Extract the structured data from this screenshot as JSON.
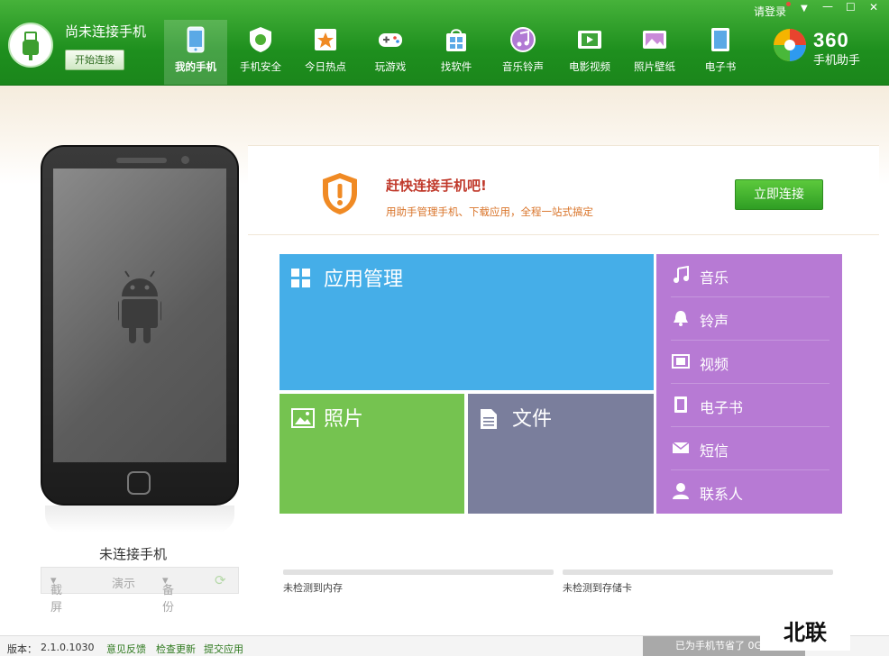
{
  "header": {
    "phone_status": "尚未连接手机",
    "connect_button": "开始连接",
    "tabs": [
      {
        "label": "我的手机",
        "icon": "phone-icon"
      },
      {
        "label": "手机安全",
        "icon": "shield-icon"
      },
      {
        "label": "今日热点",
        "icon": "star-icon"
      },
      {
        "label": "玩游戏",
        "icon": "gamepad-icon"
      },
      {
        "label": "找软件",
        "icon": "app-bag-icon"
      },
      {
        "label": "音乐铃声",
        "icon": "music-icon"
      },
      {
        "label": "电影视频",
        "icon": "film-icon"
      },
      {
        "label": "照片壁纸",
        "icon": "photo-icon"
      },
      {
        "label": "电子书",
        "icon": "book-icon"
      }
    ],
    "login": "请登录",
    "logo_number": "360",
    "logo_text": "手机助手"
  },
  "device": {
    "label": "未连接手机",
    "tools": [
      "截屏",
      "演示",
      "备份"
    ]
  },
  "notice": {
    "title": "赶快连接手机吧!",
    "desc": "用助手管理手机、下载应用，全程一站式搞定",
    "button": "立即连接"
  },
  "tiles": {
    "app": "应用管理",
    "photo": "照片",
    "file": "文件",
    "side": [
      {
        "label": "音乐",
        "icon": "music-note-icon"
      },
      {
        "label": "铃声",
        "icon": "bell-icon"
      },
      {
        "label": "视频",
        "icon": "film-strip-icon"
      },
      {
        "label": "电子书",
        "icon": "ebook-icon"
      },
      {
        "label": "短信",
        "icon": "envelope-icon"
      },
      {
        "label": "联系人",
        "icon": "contact-icon"
      }
    ]
  },
  "storage": {
    "memory": "未检测到内存",
    "card": "未检测到存储卡"
  },
  "status": {
    "version_label": "版本：",
    "version": "2.1.0.1030",
    "feedback": "意见反馈",
    "check_update": "检查更新",
    "submit_app": "提交应用",
    "saved": "已为手机节省了 0G 流量"
  },
  "watermark": "北联"
}
